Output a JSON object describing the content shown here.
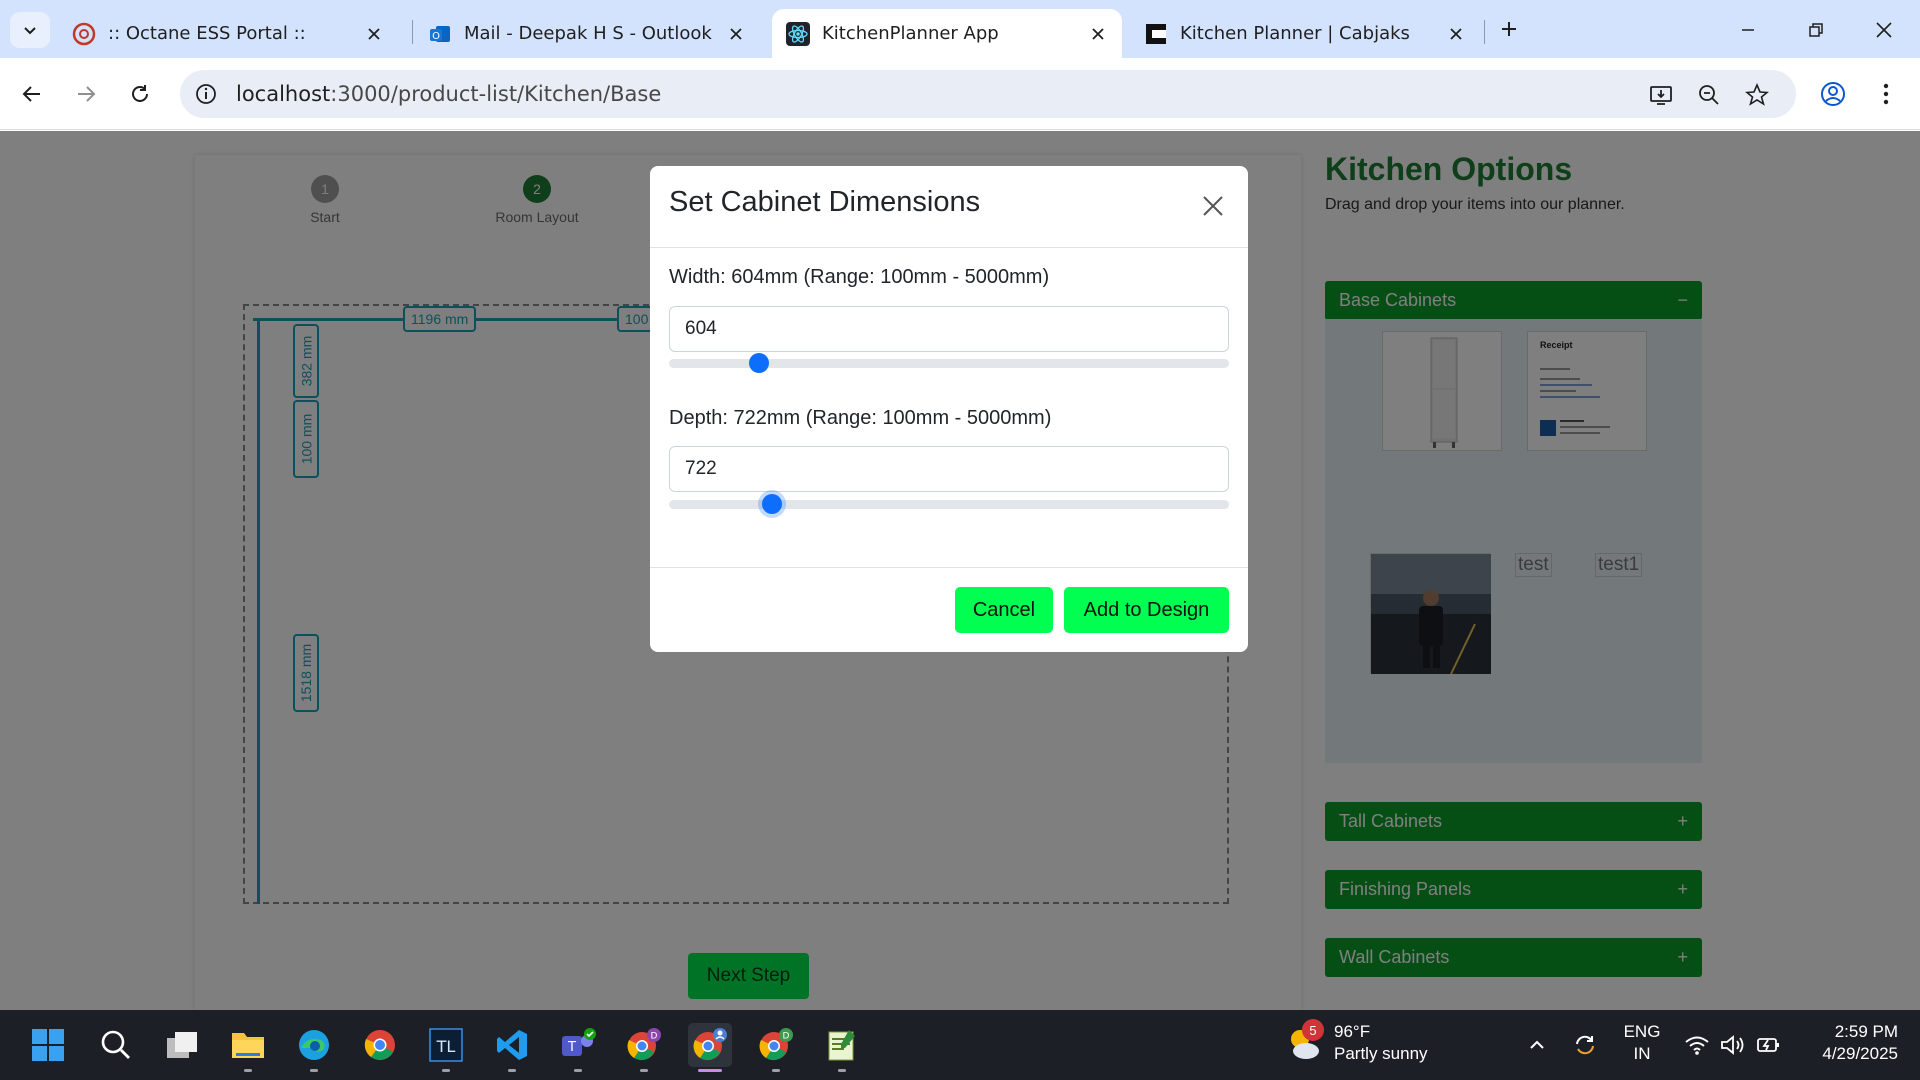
{
  "browser": {
    "tabs": [
      {
        "title": ":: Octane ESS Portal ::",
        "active": false
      },
      {
        "title": "Mail - Deepak H S - Outlook",
        "active": false
      },
      {
        "title": "KitchenPlanner App",
        "active": true
      },
      {
        "title": "Kitchen Planner | Cabjaks",
        "active": false
      }
    ],
    "url_host": "localhost",
    "url_path": ":3000/product-list/Kitchen/Base"
  },
  "steps": [
    {
      "number": "1",
      "label": "Start"
    },
    {
      "number": "2",
      "label": "Room Layout"
    }
  ],
  "planner": {
    "dims": {
      "top_wall": "1196 mm",
      "top_wall_2": "100",
      "left_1": "382 mm",
      "left_2": "100 mm",
      "left_3": "1518 mm"
    },
    "next_step_label": "Next Step"
  },
  "sidebar": {
    "title": "Kitchen Options",
    "subtitle": "Drag and drop your items into our planner.",
    "sections": [
      {
        "label": "Base Cabinets",
        "toggle": "−"
      },
      {
        "label": "Tall Cabinets",
        "toggle": "+"
      },
      {
        "label": "Finishing Panels",
        "toggle": "+"
      },
      {
        "label": "Wall Cabinets",
        "toggle": "+"
      }
    ],
    "receipt_title": "Receipt",
    "broken_images": [
      "test",
      "test1"
    ]
  },
  "modal": {
    "title": "Set Cabinet Dimensions",
    "width_label": "Width: 604mm (Range: 100mm - 5000mm)",
    "width_value": "604",
    "depth_label": "Depth: 722mm (Range: 100mm - 5000mm)",
    "depth_value": "722",
    "range_min": 100,
    "range_max": 5000,
    "width_slider": 604,
    "depth_slider": 722,
    "cancel_label": "Cancel",
    "add_label": "Add to Design",
    "accent_color": "#0d6efd",
    "button_color": "#00ff50"
  },
  "taskbar": {
    "weather_badge": "5",
    "temperature": "96°F",
    "condition": "Partly sunny",
    "lang_1": "ENG",
    "lang_2": "IN",
    "time": "2:59 PM",
    "date": "4/29/2025",
    "apps": [
      "windows-start",
      "search",
      "task-view",
      "file-explorer",
      "edge",
      "chrome",
      "tl-app",
      "vscode",
      "teams",
      "chrome-profile-d",
      "chrome-profile-active",
      "chrome-profile-d2",
      "notepad-app"
    ]
  }
}
